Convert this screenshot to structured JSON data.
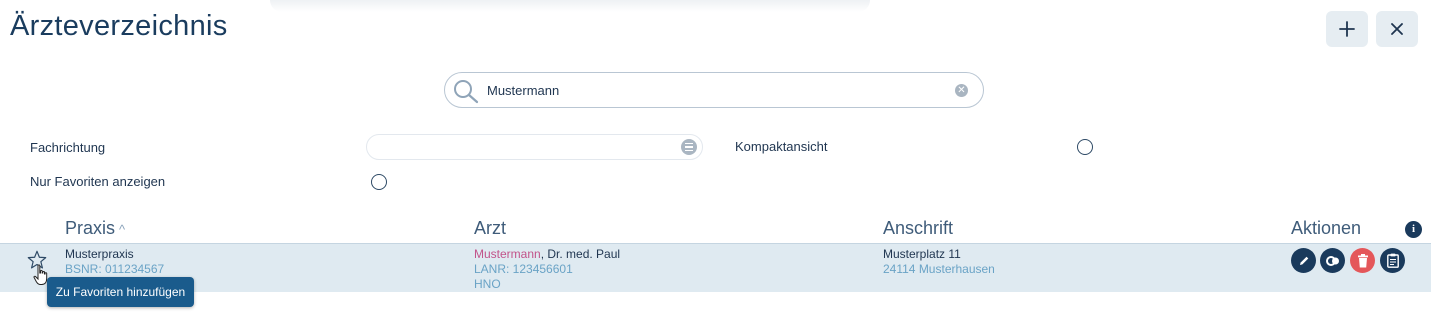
{
  "header": {
    "title": "Ärzteverzeichnis",
    "add_button_icon": "plus-icon",
    "close_button_icon": "close-icon"
  },
  "search": {
    "value": "Mustermann",
    "icon": "search-icon",
    "clear_icon": "clear-icon"
  },
  "filters": {
    "fachrichtung_label": "Fachrichtung",
    "fachrichtung_value": "",
    "kompaktansicht_label": "Kompaktansicht",
    "kompaktansicht_checked": false,
    "favoriten_label": "Nur Favoriten anzeigen",
    "favoriten_checked": false
  },
  "table": {
    "columns": {
      "praxis": "Praxis",
      "arzt": "Arzt",
      "anschrift": "Anschrift",
      "aktionen": "Aktionen"
    },
    "rows": [
      {
        "praxis_name": "Musterpraxis",
        "bsnr": "BSNR: 011234567",
        "arzt_lastname": "Mustermann",
        "arzt_rest": ", Dr. med. Paul",
        "lanr": "LANR: 123456601",
        "fach": "HNO",
        "street": "Musterplatz 11",
        "city": "24114 Musterhausen"
      }
    ]
  },
  "tooltip": {
    "text": "Zu Favoriten hinzufügen"
  },
  "actions": {
    "edit_icon": "pencil-icon",
    "link_icon": "link-icon",
    "delete_icon": "trash-icon",
    "clipboard_icon": "clipboard-icon"
  },
  "colors": {
    "primary": "#1a3a5c",
    "delete": "#e4575a",
    "row_highlight": "#dfeaf1",
    "tooltip": "#1a5b8c",
    "accent_pink": "#c2538a",
    "secondary_text": "#6aa3c6"
  }
}
